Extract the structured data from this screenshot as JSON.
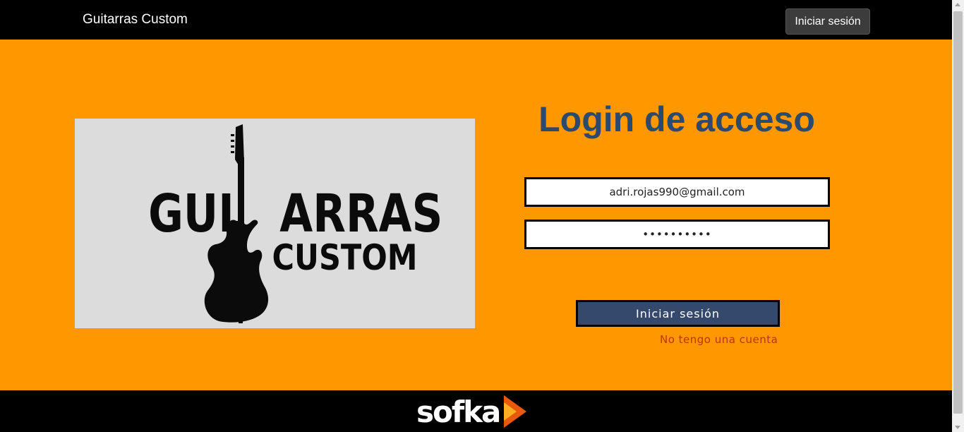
{
  "navbar": {
    "brand": "Guitarras Custom",
    "login_button": "Iniciar sesión"
  },
  "hero": {
    "logo": {
      "icon": "guitar-icon",
      "line1": "GUITARRAS",
      "line2": "CUSTOM",
      "background": "#dcdcdc"
    },
    "title": "Login de acceso",
    "email_value": "adri.rojas990@gmail.com",
    "password_value": "••••••••••",
    "submit_label": "Iniciar sesión",
    "signup_link": "No tengo una cuenta"
  },
  "footer": {
    "logo_text": "sofka",
    "logo_icon": "play-arrow-icon"
  },
  "colors": {
    "accent": "#ff9800",
    "title": "#2c4a6e",
    "button": "#34496b",
    "link": "#c0320a"
  }
}
